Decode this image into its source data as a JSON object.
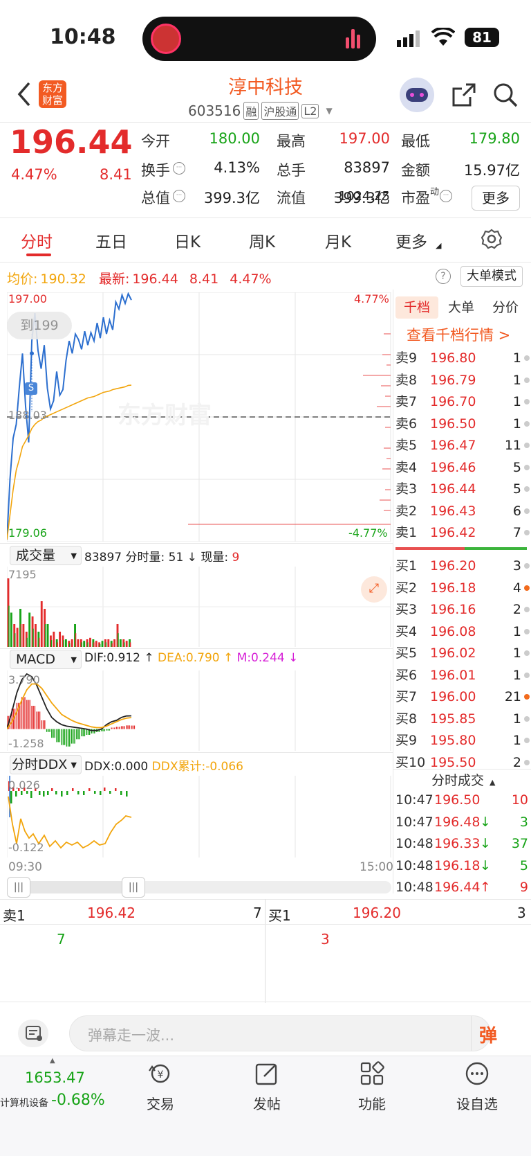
{
  "status": {
    "time": "10:48",
    "battery": "81"
  },
  "header": {
    "logo_line1": "东方",
    "logo_line2": "财富",
    "title": "淳中科技",
    "code": "603516",
    "badges": [
      "融",
      "沪股通",
      "L2"
    ]
  },
  "quote": {
    "price": "196.44",
    "pct": "4.47%",
    "chg": "8.41",
    "fields": [
      {
        "label": "今开",
        "value": "180.00",
        "color": "green"
      },
      {
        "label": "最高",
        "value": "197.00",
        "color": "red"
      },
      {
        "label": "最低",
        "value": "179.80",
        "color": "green"
      },
      {
        "label": "换手",
        "value": "4.13%",
        "color": "dark"
      },
      {
        "label": "总手",
        "value": "83897",
        "color": "dark"
      },
      {
        "label": "金额",
        "value": "15.97亿",
        "color": "dark"
      },
      {
        "label": "总值",
        "value": "399.3亿",
        "color": "dark"
      },
      {
        "label": "流值",
        "value": "399.3亿",
        "color": "dark"
      },
      {
        "label": "市盈",
        "sup": "动",
        "value": "-1024.25",
        "color": "dark"
      }
    ],
    "more_btn": "更多"
  },
  "tabs": [
    "分时",
    "五日",
    "日K",
    "周K",
    "月K",
    "更多"
  ],
  "avgbar": {
    "avg_label": "均价:",
    "avg": "190.32",
    "latest_label": "最新:",
    "latest": "196.44",
    "chg": "8.41",
    "pct": "4.47%",
    "mode_btn": "大单模式"
  },
  "chart": {
    "y_top": "197.00",
    "y_mid": "188.03",
    "y_bot": "179.06",
    "pct_top": "4.77%",
    "pct_bot": "-4.77%",
    "target_btn": "到199",
    "s_tag": "S",
    "watermark": "东方财富",
    "time_start": "09:30",
    "time_end": "15:00"
  },
  "chart_data": {
    "type": "line",
    "ylim": [
      179.06,
      197.0
    ],
    "price": [
      179.2,
      183.6,
      186.5,
      187.5,
      190.2,
      192.6,
      188.8,
      186.2,
      193.5,
      195.5,
      192.8,
      191.5,
      193.2,
      190.1,
      188.6,
      189.2,
      191.3,
      189.6,
      190.0,
      192.1,
      193.5,
      192.6,
      194.0,
      193.6,
      192.9,
      194.2,
      193.2,
      194.1,
      193.5,
      194.8,
      193.7,
      195.2,
      194.0,
      195.0,
      194.3,
      196.3,
      195.8,
      196.8,
      196.2,
      196.9,
      196.44
    ],
    "avg": [
      179.2,
      181.0,
      182.8,
      184.2,
      185.0,
      185.9,
      186.3,
      186.7,
      187.2,
      187.5,
      187.7,
      187.8,
      188.0,
      188.1,
      188.2,
      188.3,
      188.4,
      188.5,
      188.6,
      188.7,
      188.8,
      188.9,
      189.0,
      189.1,
      189.2,
      189.3,
      189.4,
      189.45,
      189.5,
      189.6,
      189.7,
      189.8,
      189.85,
      189.9,
      190.0,
      190.05,
      190.1,
      190.15,
      190.2,
      190.3,
      190.32
    ]
  },
  "volume": {
    "selector": "成交量",
    "total": "83897",
    "minute_label": "分时量:",
    "minute": "51",
    "now_label": "现量:",
    "now": "9",
    "ymax": "7195",
    "bars": [
      0.9,
      0.45,
      0.3,
      0.25,
      0.5,
      0.3,
      0.2,
      0.45,
      0.4,
      0.3,
      0.2,
      0.6,
      0.5,
      0.3,
      0.15,
      0.2,
      0.1,
      0.2,
      0.15,
      0.1,
      0.08,
      0.1,
      0.3,
      0.1,
      0.1,
      0.08,
      0.1,
      0.12,
      0.1,
      0.08,
      0.06,
      0.08,
      0.1,
      0.1,
      0.08,
      0.1,
      0.3,
      0.1,
      0.1,
      0.08,
      0.1
    ]
  },
  "macd": {
    "selector": "MACD",
    "dif": "DIF:0.912",
    "dea": "DEA:0.790",
    "m": "M:0.244",
    "ymax": "3.790",
    "ymin": "-1.258",
    "dif_line": [
      0,
      1.2,
      2.5,
      3.4,
      3.79,
      3.6,
      3.0,
      2.2,
      1.4,
      0.8,
      0.5,
      0.3,
      0.2,
      0.15,
      0.1,
      0.05,
      0,
      -0.1,
      -0.1,
      0.0,
      0.3,
      0.5,
      0.6,
      0.8,
      0.9,
      0.91
    ],
    "dea_line": [
      0,
      0.5,
      1.2,
      2.0,
      2.7,
      3.1,
      3.1,
      2.8,
      2.3,
      1.8,
      1.4,
      1.0,
      0.8,
      0.6,
      0.45,
      0.35,
      0.25,
      0.15,
      0.1,
      0.1,
      0.2,
      0.35,
      0.5,
      0.65,
      0.75,
      0.79
    ],
    "hist": [
      0.9,
      1.4,
      1.8,
      2.2,
      2.0,
      1.6,
      1.2,
      0.6,
      -0.2,
      -0.6,
      -0.9,
      -1.1,
      -1.2,
      -1.0,
      -0.7,
      -0.5,
      -0.4,
      -0.3,
      -0.2,
      -0.15,
      -0.1,
      0.1,
      0.15,
      0.2,
      0.25,
      0.24
    ]
  },
  "ddx": {
    "selector": "分时DDX",
    "ddx": "DDX:0.000",
    "sum": "DDX累计:-0.066",
    "ymax": "0.026",
    "ymin": "-0.122"
  },
  "orderbook": {
    "tabs": [
      "千档",
      "大单",
      "分价"
    ],
    "link": "查看千档行情 >",
    "asks": [
      {
        "lbl": "卖9",
        "p": "196.80",
        "q": "1"
      },
      {
        "lbl": "卖8",
        "p": "196.79",
        "q": "1"
      },
      {
        "lbl": "卖7",
        "p": "196.70",
        "q": "1"
      },
      {
        "lbl": "卖6",
        "p": "196.50",
        "q": "1"
      },
      {
        "lbl": "卖5",
        "p": "196.47",
        "q": "11"
      },
      {
        "lbl": "卖4",
        "p": "196.46",
        "q": "5"
      },
      {
        "lbl": "卖3",
        "p": "196.44",
        "q": "5"
      },
      {
        "lbl": "卖2",
        "p": "196.43",
        "q": "6"
      },
      {
        "lbl": "卖1",
        "p": "196.42",
        "q": "7"
      }
    ],
    "bids": [
      {
        "lbl": "买1",
        "p": "196.20",
        "q": "3",
        "c": "red",
        "o": false
      },
      {
        "lbl": "买2",
        "p": "196.18",
        "q": "4",
        "c": "red",
        "o": true
      },
      {
        "lbl": "买3",
        "p": "196.16",
        "q": "2",
        "c": "red",
        "o": false
      },
      {
        "lbl": "买4",
        "p": "196.08",
        "q": "1",
        "c": "red",
        "o": false
      },
      {
        "lbl": "买5",
        "p": "196.02",
        "q": "1",
        "c": "red",
        "o": false
      },
      {
        "lbl": "买6",
        "p": "196.01",
        "q": "1",
        "c": "red",
        "o": false
      },
      {
        "lbl": "买7",
        "p": "196.00",
        "q": "21",
        "c": "red",
        "o": true
      },
      {
        "lbl": "买8",
        "p": "195.85",
        "q": "1",
        "c": "red",
        "o": false
      },
      {
        "lbl": "买9",
        "p": "195.80",
        "q": "1",
        "c": "red",
        "o": false
      },
      {
        "lbl": "买10",
        "p": "195.50",
        "q": "2",
        "c": "red",
        "o": false
      }
    ]
  },
  "trades": {
    "title": "分时成交",
    "rows": [
      {
        "t": "10:47",
        "p": "196.50",
        "a": "",
        "q": "10",
        "c": "red"
      },
      {
        "t": "10:47",
        "p": "196.48",
        "a": "↓",
        "q": "3",
        "c": "green"
      },
      {
        "t": "10:48",
        "p": "196.33",
        "a": "↓",
        "q": "37",
        "c": "green"
      },
      {
        "t": "10:48",
        "p": "196.18",
        "a": "↓",
        "q": "5",
        "c": "green"
      },
      {
        "t": "10:48",
        "p": "196.44",
        "a": "↑",
        "q": "9",
        "c": "red"
      }
    ]
  },
  "bottom_quote": {
    "ask_label": "卖1",
    "ask_price": "196.42",
    "ask_qty": "7",
    "ask_count": "7",
    "bid_label": "买1",
    "bid_price": "196.20",
    "bid_qty": "3",
    "bid_count": "3"
  },
  "comment": {
    "placeholder": "弹幕走一波...",
    "danmu": "弹"
  },
  "nav": {
    "index_value": "1653.47",
    "index_name": "计算机设备",
    "index_pct": "-0.68%",
    "items": [
      "交易",
      "发帖",
      "功能",
      "设自选"
    ]
  }
}
